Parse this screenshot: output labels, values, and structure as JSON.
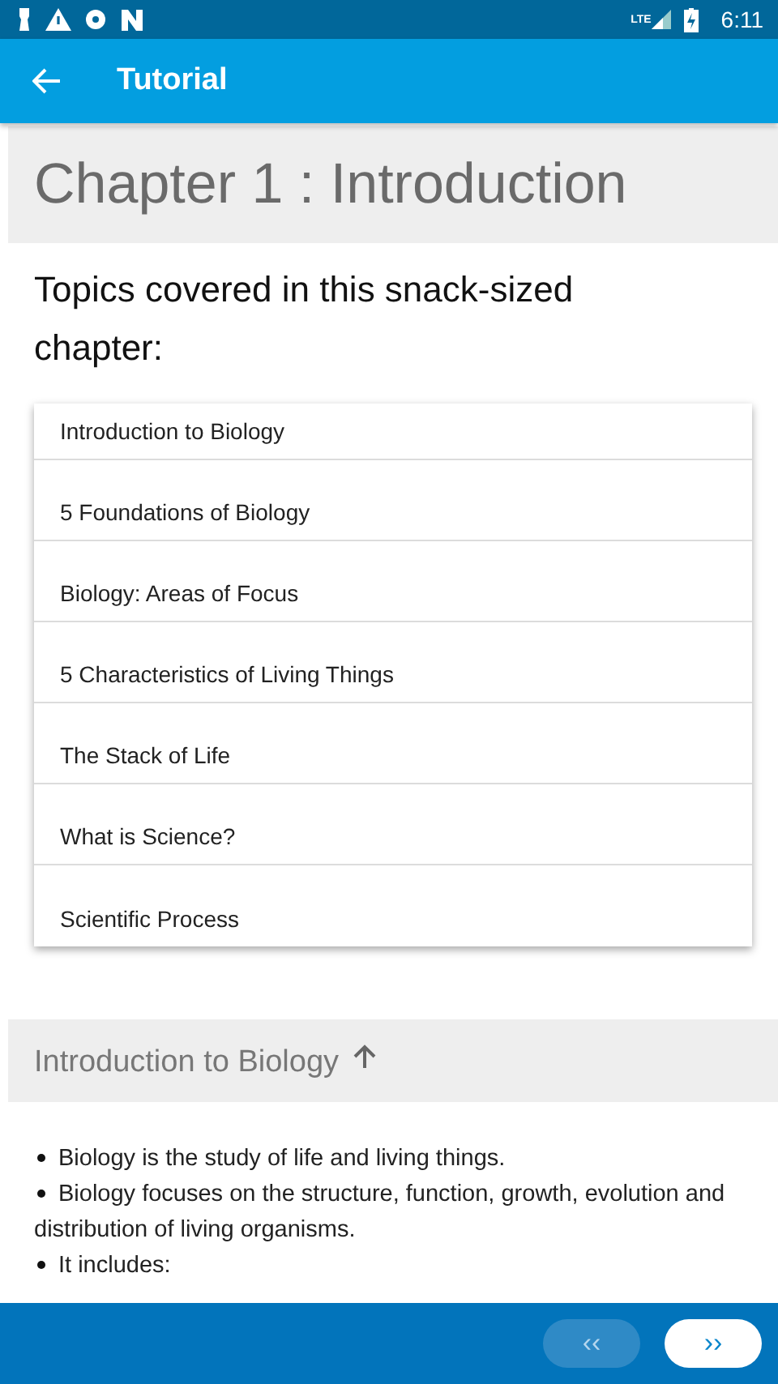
{
  "status_bar": {
    "time": "6:11",
    "network": "LTE"
  },
  "app_bar": {
    "title": "Tutorial"
  },
  "chapter": {
    "title": "Chapter 1 : Introduction"
  },
  "topics": {
    "heading": "Topics covered in this snack-sized chapter:",
    "items": [
      {
        "label": "Introduction to Biology"
      },
      {
        "label": "5 Foundations of Biology"
      },
      {
        "label": "Biology: Areas of Focus"
      },
      {
        "label": "5 Characteristics of Living Things"
      },
      {
        "label": "The Stack of Life"
      },
      {
        "label": "What is Science?"
      },
      {
        "label": "Scientific Process"
      }
    ]
  },
  "section": {
    "title": "Introduction to Biology",
    "bullets": [
      "Biology is the study of life and living things.",
      "Biology focuses on the structure, function, growth, evolution and distribution of living organisms.",
      "It includes:"
    ]
  },
  "nav": {
    "prev": {
      "label": "‹‹",
      "disabled": true
    },
    "next": {
      "label": "››",
      "disabled": false
    }
  }
}
